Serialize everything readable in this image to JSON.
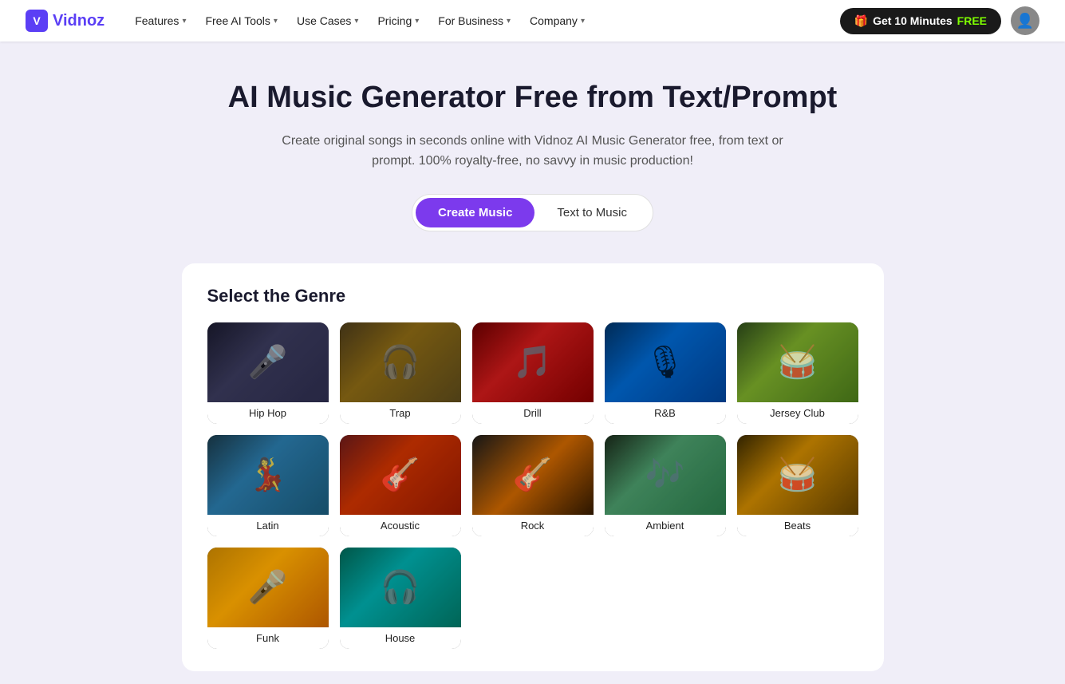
{
  "nav": {
    "logo_text": "Vidnoz",
    "items": [
      {
        "label": "Features",
        "has_dropdown": true
      },
      {
        "label": "Free AI Tools",
        "has_dropdown": true
      },
      {
        "label": "Use Cases",
        "has_dropdown": true
      },
      {
        "label": "Pricing",
        "has_dropdown": true
      },
      {
        "label": "For Business",
        "has_dropdown": true
      },
      {
        "label": "Company",
        "has_dropdown": true
      }
    ],
    "cta_label": "Get 10 Minutes",
    "cta_free": "FREE",
    "cta_icon": "🎁"
  },
  "hero": {
    "title": "AI Music Generator Free from Text/Prompt",
    "subtitle": "Create original songs in seconds online with Vidnoz AI Music Generator free, from text or prompt. 100% royalty-free, no savvy in music production!",
    "btn_primary": "Create Music",
    "btn_secondary": "Text to Music"
  },
  "genre_section": {
    "title": "Select the Genre",
    "genres": [
      {
        "id": "hiphop",
        "label": "Hip Hop",
        "theme": "genre-hiphop",
        "emoji": "🎤"
      },
      {
        "id": "trap",
        "label": "Trap",
        "theme": "genre-trap",
        "emoji": "🎧"
      },
      {
        "id": "drill",
        "label": "Drill",
        "theme": "genre-drill",
        "emoji": "🎵"
      },
      {
        "id": "rnb",
        "label": "R&B",
        "theme": "genre-rnb",
        "emoji": "🎙"
      },
      {
        "id": "jersey",
        "label": "Jersey Club",
        "theme": "genre-jersey",
        "emoji": "🥁"
      },
      {
        "id": "latin",
        "label": "Latin",
        "theme": "genre-latin",
        "emoji": "💃"
      },
      {
        "id": "acoustic",
        "label": "Acoustic",
        "theme": "genre-acoustic",
        "emoji": "🎸"
      },
      {
        "id": "rock",
        "label": "Rock",
        "theme": "genre-rock",
        "emoji": "🎸"
      },
      {
        "id": "ambient",
        "label": "Ambient",
        "theme": "genre-ambient",
        "emoji": "🎶"
      },
      {
        "id": "beats",
        "label": "Beats",
        "theme": "genre-beats",
        "emoji": "🥁"
      },
      {
        "id": "funk",
        "label": "Funk",
        "theme": "genre-funk",
        "emoji": "🎤"
      },
      {
        "id": "house",
        "label": "House",
        "theme": "genre-house",
        "emoji": "🎧"
      }
    ]
  }
}
